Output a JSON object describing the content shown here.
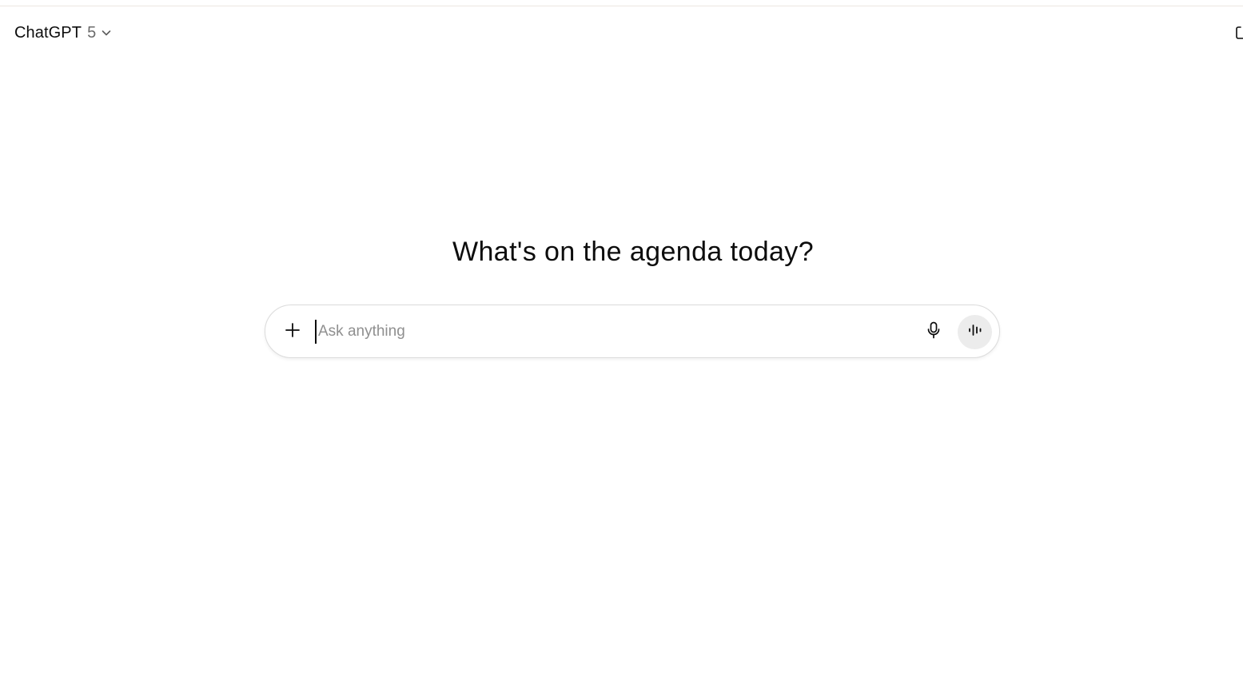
{
  "header": {
    "model_name": "ChatGPT",
    "model_version": "5",
    "chevron_icon": "chevron-down-icon",
    "edge_icon": "new-chat-icon"
  },
  "main": {
    "headline": "What's on the agenda today?"
  },
  "composer": {
    "placeholder": "Ask anything",
    "value": "",
    "plus_icon": "plus-icon",
    "mic_icon": "microphone-icon",
    "voice_icon": "voice-waveform-icon",
    "voice_button_bg": "#ececec"
  },
  "colors": {
    "text": "#0d0d0d",
    "muted": "#6b6b6b",
    "placeholder": "#8f8f8f",
    "border": "#dcdcdc"
  }
}
